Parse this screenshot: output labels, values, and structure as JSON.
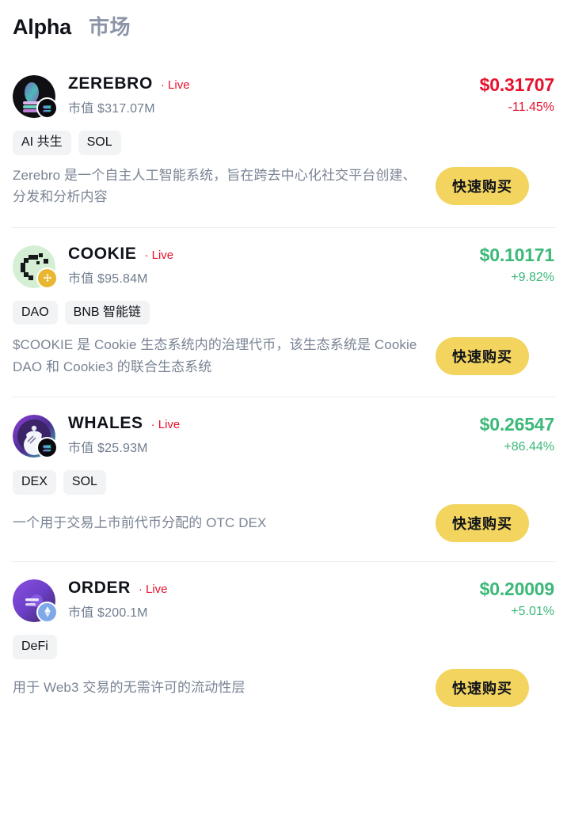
{
  "header": {
    "title": "Alpha",
    "subtitle": "市场"
  },
  "labels": {
    "live": "· Live",
    "mcap_prefix": "市值",
    "buy": "快速购买"
  },
  "colors": {
    "up": "#3cb878",
    "down": "#e8112d",
    "buy_button": "#f2d45f",
    "tag_background": "#f2f3f5",
    "muted_text": "#707d8f"
  },
  "tokens": [
    {
      "name": "ZEREBRO",
      "live": "· Live",
      "market_cap": "市值 $317.07M",
      "price": "$0.31707",
      "change": "-11.45%",
      "direction": "down",
      "chain": "sol",
      "chain_icon": "solana-icon",
      "avatar_icon": "zerebro-avatar",
      "tags": [
        "AI 共生",
        "SOL"
      ],
      "description": "Zerebro 是一个自主人工智能系统，旨在跨去中心化社交平台创建、分发和分析内容",
      "buy_label": "快速购买"
    },
    {
      "name": "COOKIE",
      "live": "· Live",
      "market_cap": "市值 $95.84M",
      "price": "$0.10171",
      "change": "+9.82%",
      "direction": "up",
      "chain": "bnb",
      "chain_icon": "bnb-icon",
      "avatar_icon": "cookie-avatar",
      "tags": [
        "DAO",
        "BNB 智能链"
      ],
      "description": "$COOKIE 是 Cookie 生态系统内的治理代币，该生态系统是 Cookie DAO 和 Cookie3 的联合生态系统",
      "buy_label": "快速购买"
    },
    {
      "name": "WHALES",
      "live": "· Live",
      "market_cap": "市值 $25.93M",
      "price": "$0.26547",
      "change": "+86.44%",
      "direction": "up",
      "chain": "sol",
      "chain_icon": "solana-icon",
      "avatar_icon": "whales-avatar",
      "tags": [
        "DEX",
        "SOL"
      ],
      "description": "一个用于交易上市前代币分配的 OTC DEX",
      "buy_label": "快速购买"
    },
    {
      "name": "ORDER",
      "live": "· Live",
      "market_cap": "市值 $200.1M",
      "price": "$0.20009",
      "change": "+5.01%",
      "direction": "up",
      "chain": "eth",
      "chain_icon": "ethereum-icon",
      "avatar_icon": "order-avatar",
      "tags": [
        "DeFi"
      ],
      "description": "用于 Web3 交易的无需许可的流动性层",
      "buy_label": "快速购买"
    }
  ]
}
